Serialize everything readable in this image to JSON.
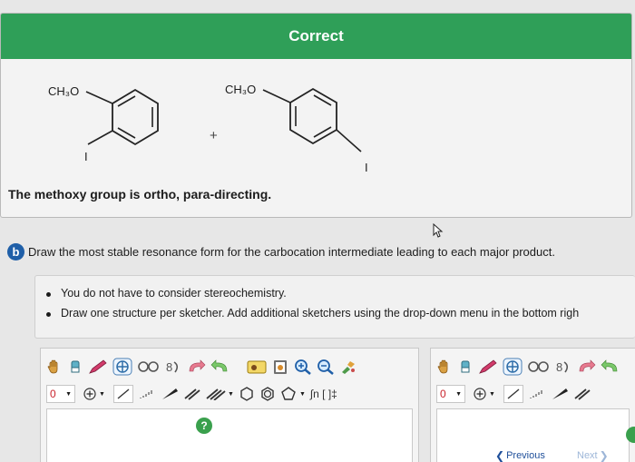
{
  "banner": {
    "status": "Correct"
  },
  "products": [
    {
      "substituent": "CH₃O",
      "halogen": "I",
      "position": "ortho"
    },
    {
      "substituent": "CH₃O",
      "halogen": "I",
      "position": "para"
    }
  ],
  "plus_sign": "+",
  "feedback_text": "The methoxy group is ortho, para-directing.",
  "part_b": {
    "badge": "b",
    "prompt": "Draw the most stable resonance form for the carbocation intermediate leading to each major product."
  },
  "instructions": [
    "You do not have to consider stereochemistry.",
    "Draw one structure per sketcher. Add additional sketchers using the drop-down menu in the bottom righ"
  ],
  "toolbar": {
    "charge_value": "0",
    "template_labels": "∫n [ ]‡",
    "help_label": "?"
  },
  "nav": {
    "previous": "Previous",
    "next": "Next"
  },
  "colors": {
    "banner": "#2f9f58",
    "badge": "#1f5fa8",
    "help": "#3aa04d",
    "link": "#1f4f9a"
  },
  "icons": [
    "hand-icon",
    "eraser-icon",
    "pencil-icon",
    "atom-icon",
    "ring-icon",
    "undo-icon",
    "redo-icon",
    "zoom-in-icon",
    "zoom-out-icon",
    "bond-icon"
  ]
}
